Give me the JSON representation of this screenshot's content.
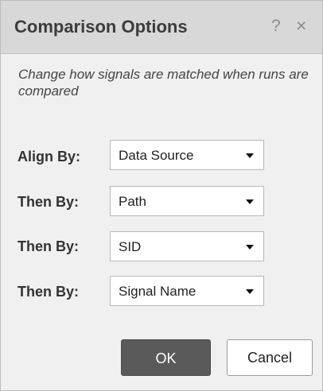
{
  "dialog": {
    "title": "Comparison Options",
    "help_glyph": "?",
    "close_glyph": "×",
    "description": "Change how signals are matched when runs are compared"
  },
  "options": [
    {
      "label": "Align By:",
      "value": "Data Source"
    },
    {
      "label": "Then By:",
      "value": "Path"
    },
    {
      "label": "Then By:",
      "value": "SID"
    },
    {
      "label": "Then By:",
      "value": "Signal Name"
    }
  ],
  "buttons": {
    "ok_label": "OK",
    "cancel_label": "Cancel"
  },
  "colors": {
    "titlebar": "#d8d8d8",
    "body": "#f0f0f0",
    "ok_button": "#5a5a5a"
  },
  "icons": {
    "help": "question-mark-icon",
    "close": "close-icon",
    "dropdown": "caret-down-icon"
  }
}
